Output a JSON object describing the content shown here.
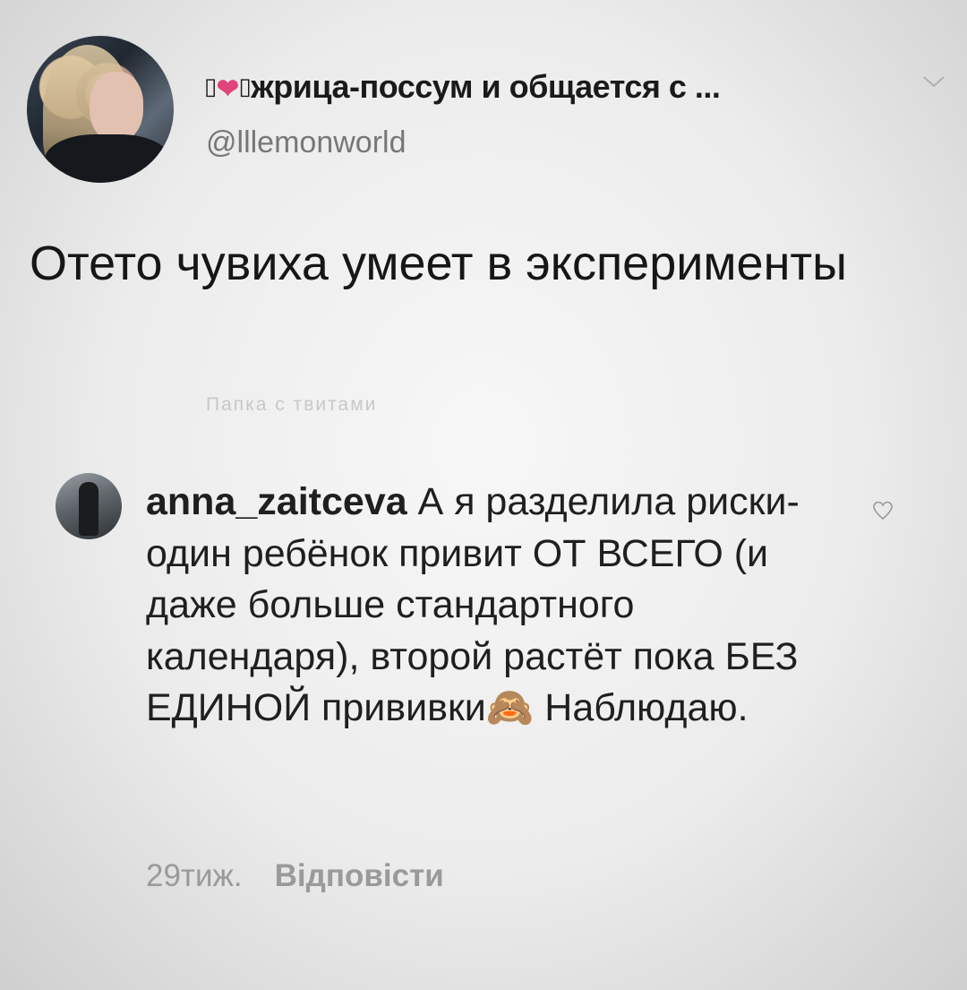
{
  "header": {
    "prefix_glyph_1": "▯",
    "heart_glyph": "❤",
    "prefix_glyph_2": "▯",
    "name": "жрица-поссум и общается с ...",
    "handle": "@lllemonworld"
  },
  "tweet": {
    "text": "Отето чувиха умеет в эксперименты"
  },
  "ghost_text": "Папка с твитами",
  "comment": {
    "username": "anna_zaitceva",
    "text": "А я разделила риски- один ребёнок привит ОТ ВСЕГО (и даже больше стандартного календаря), второй растёт пока БЕЗ ЕДИНОЙ прививки🙈 Наблюдаю.",
    "time": "29тиж.",
    "reply_label": "Відповісти"
  },
  "icons": {
    "chevron": "chevron-down-icon",
    "like": "heart-outline-icon"
  },
  "colors": {
    "heart": "#e0447a",
    "muted": "#9a9a9a",
    "handle": "#777777"
  }
}
